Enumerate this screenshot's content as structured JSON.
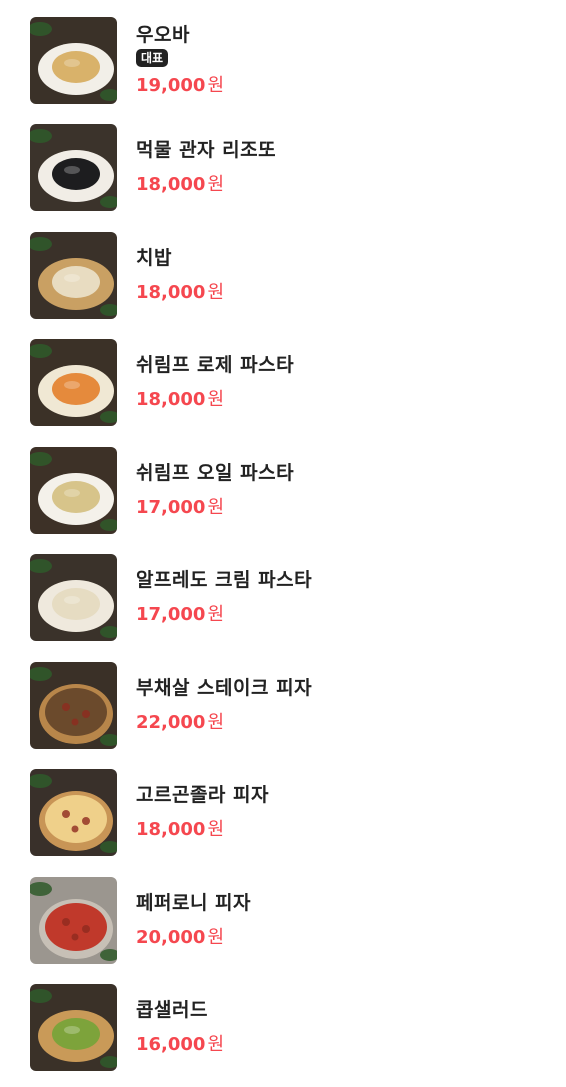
{
  "menu": {
    "items": [
      {
        "name": "우오바",
        "badge": "대표",
        "price": "19,000",
        "unit": "원",
        "image_icon": "dish-photo-icon",
        "plate": "#f2efe8",
        "food": "#d9b26a",
        "bg": "#3a3128"
      },
      {
        "name": "먹물 관자 리조또",
        "badge": "",
        "price": "18,000",
        "unit": "원",
        "image_icon": "dish-photo-icon",
        "plate": "#f1ede6",
        "food": "#1d1d1f",
        "bg": "#3b332b"
      },
      {
        "name": "치밥",
        "badge": "",
        "price": "18,000",
        "unit": "원",
        "image_icon": "dish-photo-icon",
        "plate": "#c9a063",
        "food": "#e8dcc1",
        "bg": "#3a3129"
      },
      {
        "name": "쉬림프 로제 파스타",
        "badge": "",
        "price": "18,000",
        "unit": "원",
        "image_icon": "dish-photo-icon",
        "plate": "#f0e8d4",
        "food": "#e58a3c",
        "bg": "#3b3127"
      },
      {
        "name": "쉬림프 오일 파스타",
        "badge": "",
        "price": "17,000",
        "unit": "원",
        "image_icon": "dish-photo-icon",
        "plate": "#f4f1ea",
        "food": "#d7c48a",
        "bg": "#3d3127"
      },
      {
        "name": "알프레도 크림 파스타",
        "badge": "",
        "price": "17,000",
        "unit": "원",
        "image_icon": "dish-photo-icon",
        "plate": "#efe9dd",
        "food": "#e6dcc2",
        "bg": "#3a322a"
      },
      {
        "name": "부채살 스테이크 피자",
        "badge": "",
        "price": "22,000",
        "unit": "원",
        "image_icon": "dish-photo-icon",
        "plate": "#b8864a",
        "food": "#6b4a2c",
        "bg": "#3a3027"
      },
      {
        "name": "고르곤졸라 피자",
        "badge": "",
        "price": "18,000",
        "unit": "원",
        "image_icon": "dish-photo-icon",
        "plate": "#c89556",
        "food": "#efd08a",
        "bg": "#39302a"
      },
      {
        "name": "페퍼로니 피자",
        "badge": "",
        "price": "20,000",
        "unit": "원",
        "image_icon": "dish-photo-icon",
        "plate": "#c7c0b6",
        "food": "#c0392b",
        "bg": "#9b968f"
      },
      {
        "name": "콥샐러드",
        "badge": "",
        "price": "16,000",
        "unit": "원",
        "image_icon": "dish-photo-icon",
        "plate": "#c99a58",
        "food": "#7da33b",
        "bg": "#3a3128"
      }
    ]
  }
}
